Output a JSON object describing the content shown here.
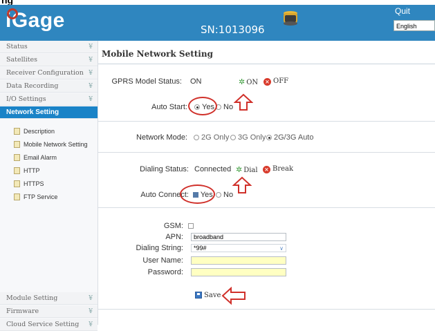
{
  "window": {
    "title_fragment": "ng"
  },
  "header": {
    "logo": "iGage",
    "serial": "SN:1013096",
    "quit_label": "Quit",
    "language": "English",
    "brand_color": "#2f86bf"
  },
  "sidebar": {
    "top_items": [
      {
        "label": "Status"
      },
      {
        "label": "Satellites"
      },
      {
        "label": "Receiver Configuration"
      },
      {
        "label": "Data Recording"
      },
      {
        "label": "I/O Settings"
      }
    ],
    "active_item": "Network Setting",
    "sub_items": [
      {
        "label": "Description"
      },
      {
        "label": "Mobile Network Setting"
      },
      {
        "label": "Email Alarm"
      },
      {
        "label": "HTTP"
      },
      {
        "label": "HTTPS"
      },
      {
        "label": "FTP Service"
      }
    ],
    "bottom_items": [
      {
        "label": "Module Setting"
      },
      {
        "label": "Firmware"
      },
      {
        "label": "Cloud Service Setting"
      }
    ],
    "chevron_icon": "double-chevron-down-icon",
    "doc_icon": "document-icon",
    "active_color": "#1a83c7"
  },
  "main": {
    "title": "Mobile Network Setting",
    "gprs": {
      "label": "GPRS Model Status:",
      "value": "ON",
      "on_label": "ON",
      "off_label": "OFF"
    },
    "auto_start": {
      "label": "Auto Start:",
      "yes_label": "Yes",
      "no_label": "No",
      "selected": "Yes"
    },
    "network_mode": {
      "label": "Network Mode:",
      "options": [
        "2G Only",
        "3G Only",
        "2G/3G Auto"
      ],
      "selected": "2G/3G Auto"
    },
    "dialing": {
      "label": "Dialing Status:",
      "value": "Connected",
      "dial_label": "Dial",
      "break_label": "Break"
    },
    "auto_connect": {
      "label": "Auto Connect:",
      "yes_label": "Yes",
      "no_label": "No",
      "checked": "Yes"
    },
    "form": {
      "gsm_label": "GSM:",
      "apn_label": "APN:",
      "apn_value": "broadband",
      "dialing_string_label": "Dialing String:",
      "dialing_string_value": "*99#",
      "username_label": "User Name:",
      "username_value": "",
      "password_label": "Password:",
      "password_value": ""
    },
    "save_label": "Save",
    "annotation_color": "#d0302a"
  }
}
